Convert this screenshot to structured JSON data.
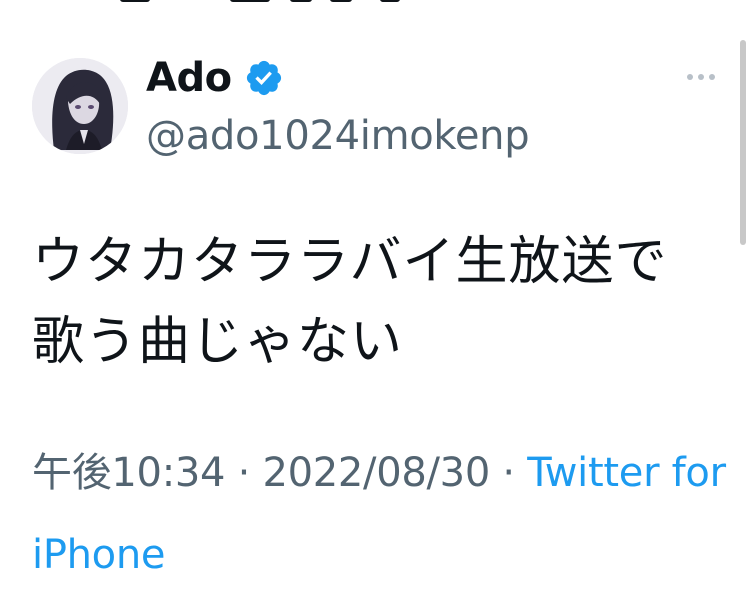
{
  "tweet": {
    "author": {
      "display_name": "Ado",
      "handle": "@ado1024imokenp",
      "verified": true
    },
    "text_line1": "ウタカタララバイ生放送で",
    "text_line2": "歌う曲じゃない",
    "time": "午後10:34",
    "separator": " · ",
    "date": "2022/08/30",
    "source": "Twitter for iPhone"
  },
  "colors": {
    "text": "#0f1419",
    "secondary": "#536471",
    "accent": "#1d9bf0"
  },
  "icons": {
    "verified": "verified-badge-icon",
    "more": "more-options-icon"
  }
}
